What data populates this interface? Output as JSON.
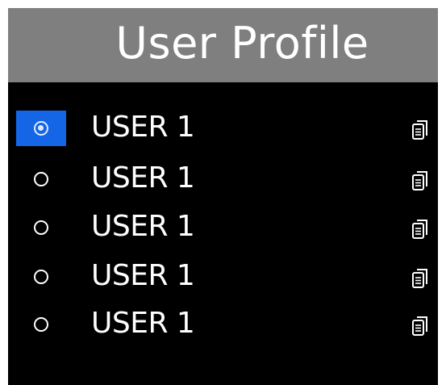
{
  "header": {
    "title": "User Profile"
  },
  "users": [
    {
      "label": "USER 1",
      "selected": true,
      "icon": "document-icon"
    },
    {
      "label": "USER 1",
      "selected": false,
      "icon": "document-icon"
    },
    {
      "label": "USER 1",
      "selected": false,
      "icon": "document-icon"
    },
    {
      "label": "USER 1",
      "selected": false,
      "icon": "document-icon"
    },
    {
      "label": "USER 1",
      "selected": false,
      "icon": "document-icon"
    }
  ],
  "colors": {
    "header_bg": "#7f7f7f",
    "screen_bg": "#000000",
    "selection": "#1466e6",
    "text": "#ffffff"
  }
}
